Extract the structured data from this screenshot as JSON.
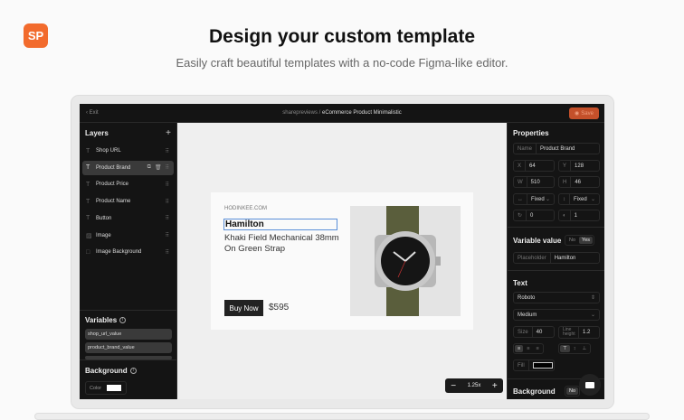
{
  "hero": {
    "logo": "SP",
    "title": "Design your custom template",
    "subtitle": "Easily craft beautiful templates with a no-code Figma-like editor."
  },
  "topbar": {
    "exit": "Exit",
    "workspace": "sharepreviews",
    "separator": " / ",
    "template": "eCommerce Product Minimalistic",
    "save": "Save"
  },
  "layers": {
    "title": "Layers",
    "items": [
      {
        "label": "Shop URL",
        "icon": "text-icon"
      },
      {
        "label": "Product Brand",
        "icon": "text-icon",
        "selected": true
      },
      {
        "label": "Product Price",
        "icon": "text-icon"
      },
      {
        "label": "Product Name",
        "icon": "text-icon"
      },
      {
        "label": "Button",
        "icon": "text-icon"
      },
      {
        "label": "Image",
        "icon": "image-icon"
      },
      {
        "label": "Image Background",
        "icon": "rect-icon"
      }
    ]
  },
  "variables": {
    "title": "Variables",
    "items": [
      "shop_url_value",
      "product_brand_value"
    ]
  },
  "background": {
    "title": "Background",
    "color_label": "Color",
    "color": "#ffffff"
  },
  "card": {
    "url": "HODINKEE.COM",
    "brand": "Hamilton",
    "name": "Khaki Field Mechanical 38mm On Green Strap",
    "button": "Buy Now",
    "price": "$595"
  },
  "zoom": {
    "minus": "−",
    "level": "1.25x",
    "plus": "+"
  },
  "properties": {
    "title": "Properties",
    "name_label": "Name",
    "name": "Product Brand",
    "x": "64",
    "y": "128",
    "w": "510",
    "h": "46",
    "width_mode": "Fixed",
    "height_mode": "Fixed",
    "rotation": "0",
    "opacity": "1"
  },
  "variable_value": {
    "title": "Variable value",
    "options": [
      "No",
      "Yes"
    ],
    "selected": "Yes",
    "placeholder_label": "Placeholder",
    "placeholder": "Hamilton"
  },
  "text": {
    "title": "Text",
    "font": "Roboto",
    "weight": "Medium",
    "size_label": "Size",
    "size": "40",
    "line_height_label": "Line height",
    "line_height": "1.2",
    "fill_label": "Fill",
    "fill": "#000000"
  },
  "background_right": {
    "title": "Background",
    "option": "No"
  },
  "colors": {
    "accent": "#f26b2d",
    "save": "#c4502a",
    "selection": "#5a8fd8"
  }
}
